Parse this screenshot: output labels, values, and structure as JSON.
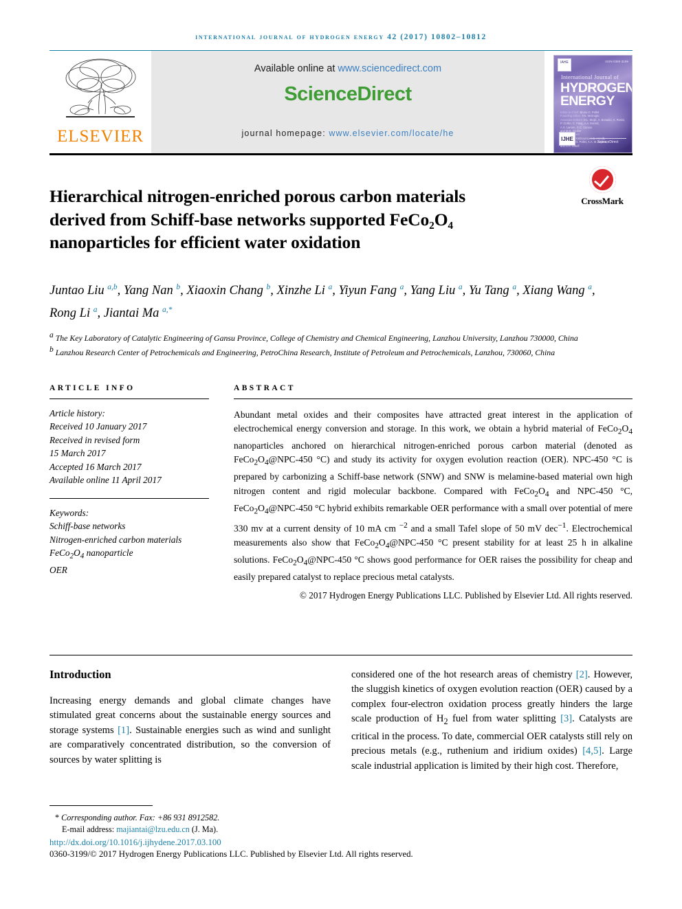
{
  "running_head": "International Journal of Hydrogen Energy 42 (2017) 10802–10812",
  "masthead": {
    "publisher_name": "ELSEVIER",
    "available_prefix": "Available online at ",
    "available_link": "www.sciencedirect.com",
    "brand_part1": "Science",
    "brand_part2": "Direct",
    "homepage_label": "journal homepage: ",
    "homepage_link": "www.elsevier.com/locate/he",
    "cover": {
      "ihe_mark": "IAHE",
      "issn": "ISSN 0360-3199",
      "line_small": "International Journal of",
      "line_big_1": "HYDROGEN",
      "line_big_2": "ENERGY",
      "editors_label_1": "Editor-in-Chief:",
      "editors_label_2": "Founding Editor:",
      "editors_label_3": "Associate Editors:",
      "editors_1": "Bruno G. Pollet",
      "editors_2": "T.N. Veziroglu",
      "editors_3": "D.L. Stojić, A. Bonadio, A. Rosini,",
      "editors_4": "P. Corbo, C. Fang, A.A. Evrard,",
      "editors_5": "A.S. Larsen, G.C. Caruso",
      "editors_6": "and M.D. Gruber",
      "section_label": "Section Editors:",
      "section_1": "A. Bazzi, C. Kaltsounis, A.S. Arendt,",
      "section_2": "T.Y. Park, B.G. Pollet, A.A. M. Aspina,",
      "section_3": "and S.A. Sherif",
      "hex_mark": "IJHE",
      "publisher": "ScienceDirect"
    }
  },
  "title": "Hierarchical nitrogen-enriched porous carbon materials derived from Schiff-base networks supported FeCo₂O₄ nanoparticles for efficient water oxidation",
  "crossmark_label": "CrossMark",
  "authors_html": "Juntao Liu <sup>a,b</sup>, Yang Nan <sup>b</sup>, Xiaoxin Chang <sup>b</sup>, Xinzhe Li <sup>a</sup>, Yiyun Fang <sup>a</sup>, Yang Liu <sup>a</sup>, Yu Tang <sup>a</sup>, Xiang Wang <sup>a</sup>, Rong Li <sup>a</sup>, Jiantai Ma <sup>a,*</sup>",
  "affiliations_html": "<sup>a</sup> The Key Laboratory of Catalytic Engineering of Gansu Province, College of Chemistry and Chemical Engineering, Lanzhou University, Lanzhou 730000, China<br><sup>b</sup> Lanzhou Research Center of Petrochemicals and Engineering, PetroChina Research, Institute of Petroleum and Petrochemicals, Lanzhou, 730060, China",
  "article_info": {
    "heading": "ARTICLE INFO",
    "history_label": "Article history:",
    "history": [
      "Received 10 January 2017",
      "Received in revised form",
      "15 March 2017",
      "Accepted 16 March 2017",
      "Available online 11 April 2017"
    ],
    "keywords_label": "Keywords:",
    "keywords_html": [
      "Schiff-base networks",
      "Nitrogen-enriched carbon materials",
      "FeCo<sub>2</sub>O<sub>4</sub> nanoparticle",
      "OER"
    ]
  },
  "abstract": {
    "heading": "ABSTRACT",
    "body_html": "Abundant metal oxides and their composites have attracted great interest in the application of electrochemical energy conversion and storage. In this work, we obtain a hybrid material of FeCo<sub>2</sub>O<sub>4</sub> nanoparticles anchored on hierarchical nitrogen-enriched porous carbon material (denoted as FeCo<sub>2</sub>O<sub>4</sub>@NPC-450 &deg;C) and study its activity for oxygen evolution reaction (OER). NPC-450 &deg;C is prepared by carbonizing a Schiff-base network (SNW) and SNW is melamine-based material own high nitrogen content and rigid molecular backbone. Compared with FeCo<sub>2</sub>O<sub>4</sub> and NPC-450 &deg;C, FeCo<sub>2</sub>O<sub>4</sub>@NPC-450 &deg;C hybrid exhibits remarkable OER performance with a small over potential of mere 330 mv at a current density of 10 mA cm <sup>&minus;2</sup> and a small Tafel slope of 50 mV dec<sup>&minus;1</sup>. Electrochemical measurements also show that FeCo<sub>2</sub>O<sub>4</sub>@NPC-450 &deg;C present stability for at least 25 h in alkaline solutions. FeCo<sub>2</sub>O<sub>4</sub>@NPC-450 &deg;C shows good performance for OER raises the possibility for cheap and easily prepared catalyst to replace precious metal catalysts.",
    "copyright": "© 2017 Hydrogen Energy Publications LLC. Published by Elsevier Ltd. All rights reserved."
  },
  "introduction": {
    "heading": "Introduction",
    "left_html": "Increasing energy demands and global climate changes have stimulated great concerns about the sustainable energy sources and storage systems <span class=\"ref\">[1]</span>. Sustainable energies such as wind and sunlight are comparatively concentrated distribution, so the conversion of sources by water splitting is",
    "right_html": "considered one of the hot research areas of chemistry <span class=\"ref\">[2]</span>. However, the sluggish kinetics of oxygen evolution reaction (OER) caused by a complex four-electron oxidation process greatly hinders the large scale production of H<sub>2</sub> fuel from water splitting <span class=\"ref\">[3]</span>. Catalysts are critical in the process. To date, commercial OER catalysts still rely on precious metals (e.g., ruthenium and iridium oxides) <span class=\"ref\">[4,5]</span>. Large scale industrial application is limited by their high cost. Therefore,"
  },
  "footer": {
    "corresponding": "Corresponding author. Fax: +86 931 8912582.",
    "email_label": "E-mail address: ",
    "email": "majiantai@lzu.edu.cn",
    "email_suffix": " (J. Ma).",
    "doi": "http://dx.doi.org/10.1016/j.ijhydene.2017.03.100",
    "issn_line": "0360-3199/© 2017 Hydrogen Energy Publications LLC. Published by Elsevier Ltd. All rights reserved."
  },
  "colors": {
    "link": "#1a7fa8",
    "elsevier_orange": "#f08000",
    "sciencedirect_green": "#3f9c35",
    "crossmark_red": "#d9262c"
  }
}
